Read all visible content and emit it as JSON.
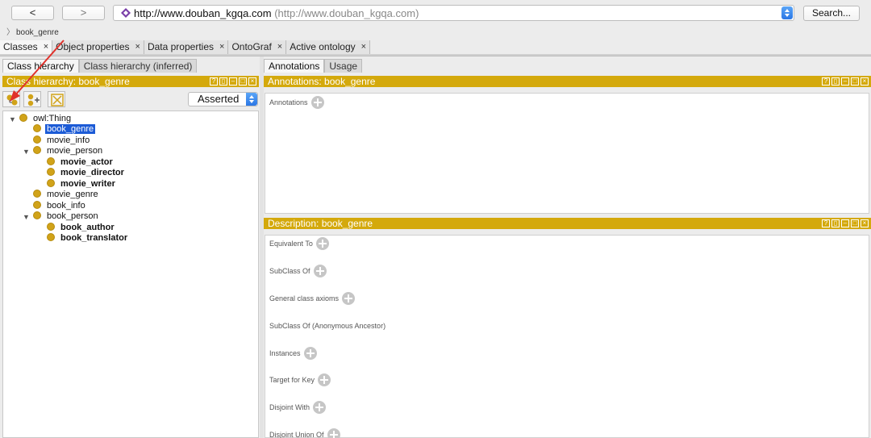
{
  "toolbar": {
    "back_label": "<",
    "forward_label": ">",
    "url_main": "http://www.douban_kgqa.com",
    "url_sub": "(http://www.douban_kgqa.com)",
    "search_label": "Search...",
    "url_icon": "ontology-diamond-icon"
  },
  "breadcrumb": {
    "label": "book_genre"
  },
  "main_tabs": [
    {
      "label": "Classes",
      "close": "×"
    },
    {
      "label": "Object properties",
      "close": "×"
    },
    {
      "label": "Data properties",
      "close": "×"
    },
    {
      "label": "OntoGraf",
      "close": "×"
    },
    {
      "label": "Active ontology",
      "close": "×"
    }
  ],
  "left": {
    "subtabs": [
      "Class hierarchy",
      "Class hierarchy (inferred)"
    ],
    "header": "Class hierarchy: book_genre",
    "mode_select": "Asserted",
    "tools": [
      "add-subclass-icon",
      "add-sibling-icon",
      "delete-class-icon"
    ],
    "tree": [
      {
        "label": "owl:Thing",
        "level": 0,
        "expanded": true,
        "bold": false
      },
      {
        "label": "book_genre",
        "level": 1,
        "selected": true,
        "bold": false
      },
      {
        "label": "movie_info",
        "level": 1,
        "bold": false
      },
      {
        "label": "movie_person",
        "level": 1,
        "expanded": true,
        "bold": false
      },
      {
        "label": "movie_actor",
        "level": 2,
        "bold": true
      },
      {
        "label": "movie_director",
        "level": 2,
        "bold": true
      },
      {
        "label": "movie_writer",
        "level": 2,
        "bold": true
      },
      {
        "label": "movie_genre",
        "level": 1,
        "bold": false
      },
      {
        "label": "book_info",
        "level": 1,
        "bold": false
      },
      {
        "label": "book_person",
        "level": 1,
        "expanded": true,
        "bold": false
      },
      {
        "label": "book_author",
        "level": 2,
        "bold": true
      },
      {
        "label": "book_translator",
        "level": 2,
        "bold": true
      }
    ]
  },
  "right": {
    "subtabs": [
      "Annotations",
      "Usage"
    ],
    "annotations_header": "Annotations: book_genre",
    "annotations_label": "Annotations",
    "description_header": "Description: book_genre",
    "description_sections": [
      {
        "label": "Equivalent To",
        "add": true
      },
      {
        "label": "SubClass Of",
        "add": true
      },
      {
        "label": "General class axioms",
        "add": true
      },
      {
        "label": "SubClass Of (Anonymous Ancestor)",
        "add": false
      },
      {
        "label": "Instances",
        "add": true
      },
      {
        "label": "Target for Key",
        "add": true
      },
      {
        "label": "Disjoint With",
        "add": true
      },
      {
        "label": "Disjoint Union Of",
        "add": true
      }
    ]
  },
  "colors": {
    "header_gold": "#d4a90c",
    "selection_blue": "#1c5bd6",
    "class_dot": "#d1a319",
    "annotation_arrow": "#e0312b"
  }
}
